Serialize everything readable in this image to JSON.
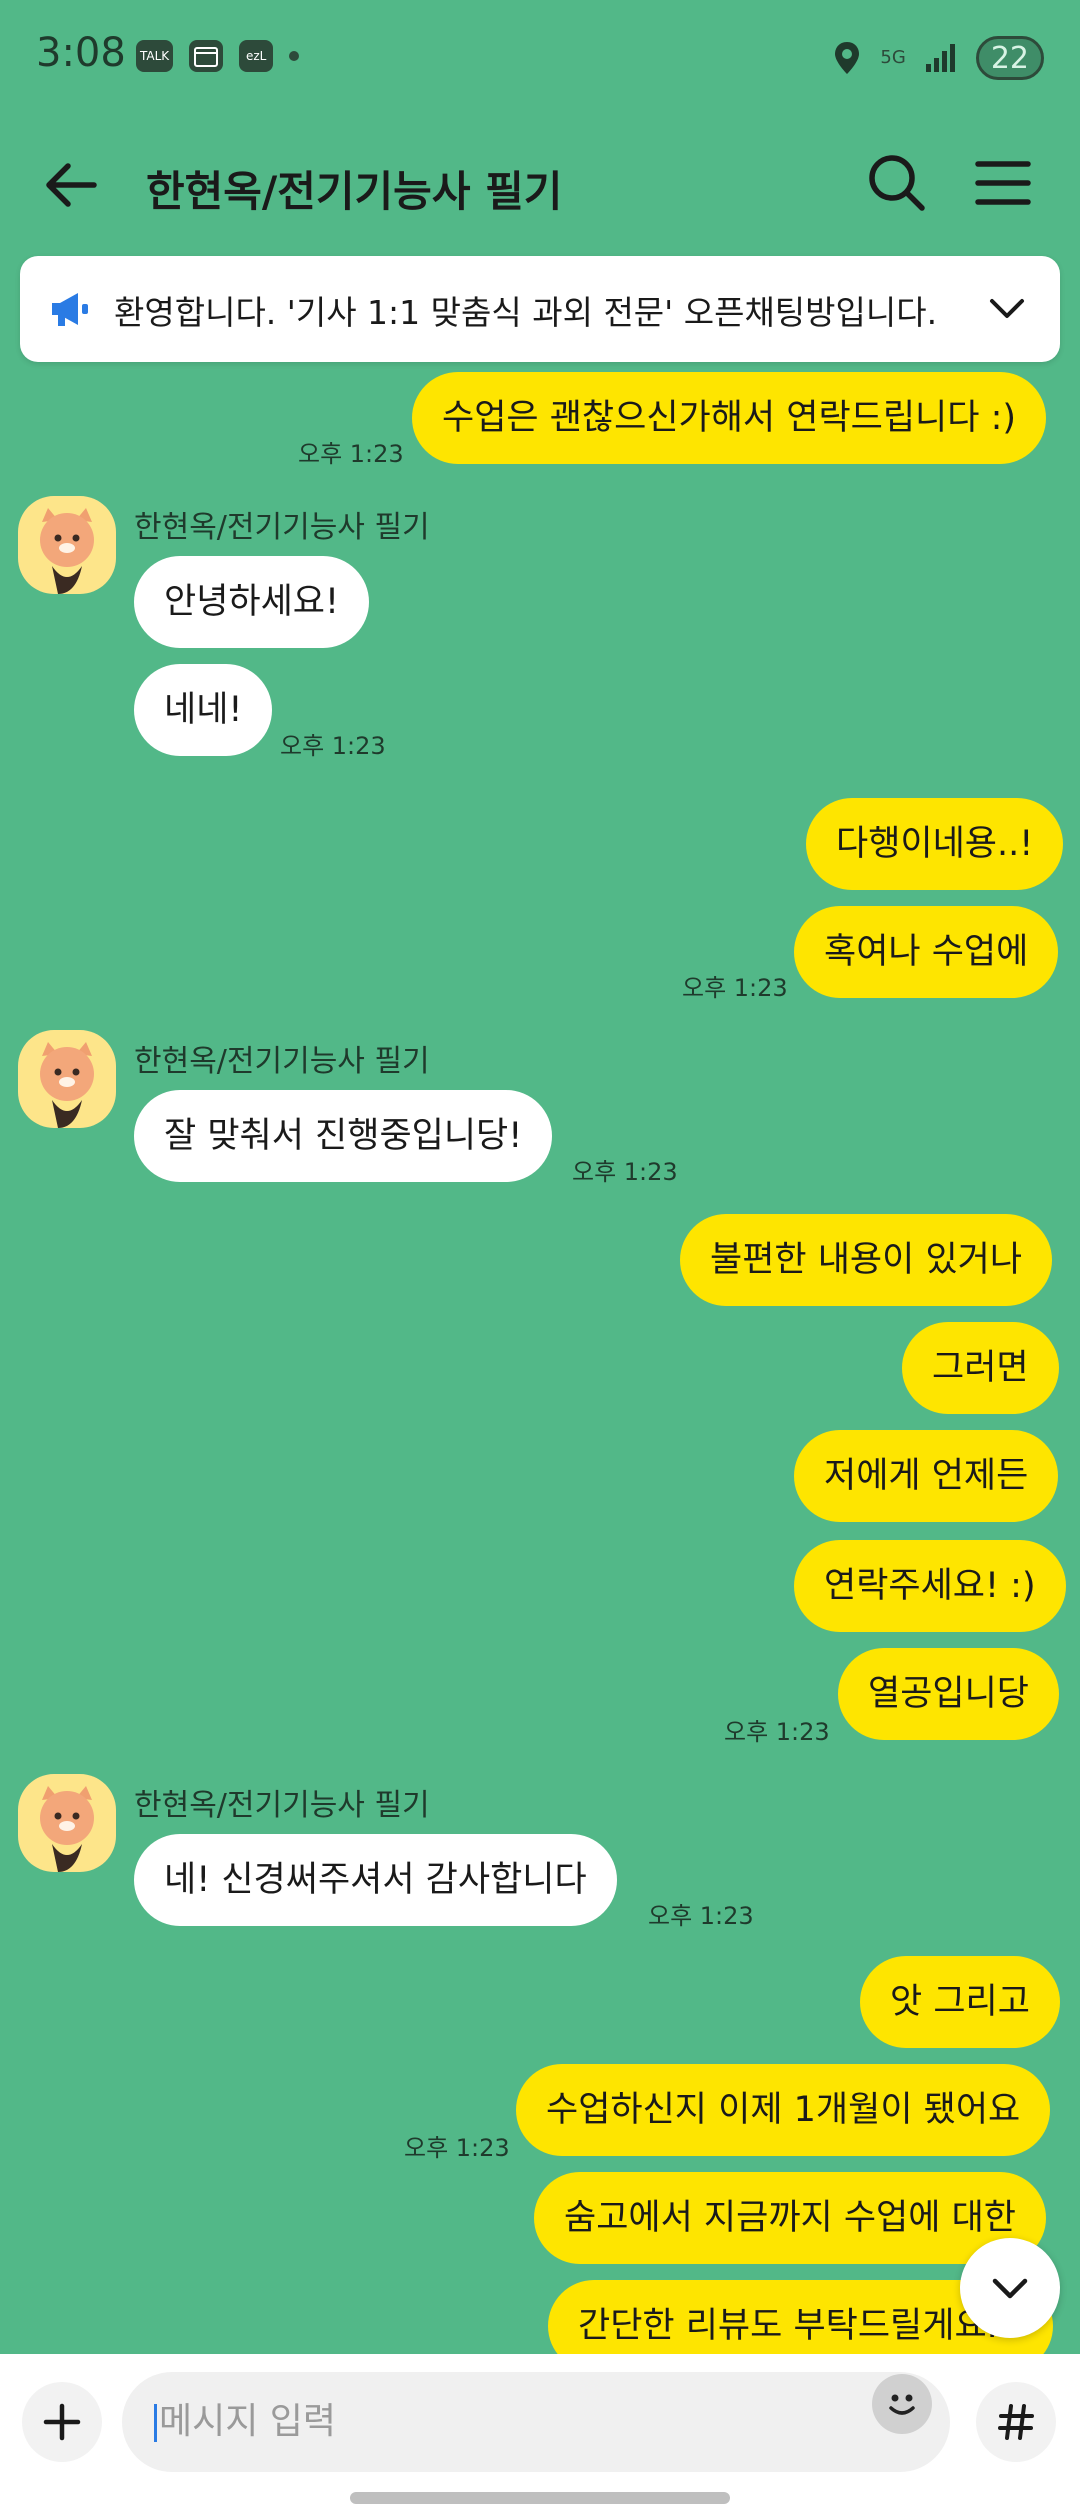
{
  "status_bar": {
    "time": "3:08",
    "chips": [
      "TALK",
      "",
      "ezL"
    ],
    "network": "5G",
    "battery": "22"
  },
  "header": {
    "title": "한현옥/전기기능사 필기"
  },
  "notice": {
    "text": "환영합니다. '기사 1:1 맞춤식 과외 전문' 오픈채팅방입니다."
  },
  "messages": [
    {
      "text": "수업은 괜찮으신가해서 연락드립니다 :)",
      "time": "오후 1:23"
    },
    {
      "sender": "한현옥/전기기능사 필기",
      "text": "안녕하세요!"
    },
    {
      "text": "네네!",
      "time": "오후 1:23"
    },
    {
      "text": "다행이네용..!"
    },
    {
      "text": "혹여나 수업에",
      "time": "오후 1:23"
    },
    {
      "sender": "한현옥/전기기능사 필기",
      "text": "잘 맞춰서 진행중입니당!",
      "time": "오후 1:23"
    },
    {
      "text": "불편한 내용이 있거나"
    },
    {
      "text": "그러면"
    },
    {
      "text": "저에게 언제든"
    },
    {
      "text": "연락주세요! :)"
    },
    {
      "text": "열공입니당",
      "time": "오후 1:23"
    },
    {
      "sender": "한현옥/전기기능사 필기",
      "text": "네! 신경써주셔서 감사합니다",
      "time": "오후 1:23"
    },
    {
      "text": "앗 그리고"
    },
    {
      "text": "수업하신지 이제 1개월이 됐어요",
      "time": "오후 1:23"
    },
    {
      "text": "숨고에서 지금까지 수업에 대한"
    },
    {
      "text": "간단한 리뷰도 부탁드릴게요..!"
    }
  ],
  "input": {
    "placeholder": "메시지 입력"
  },
  "colors": {
    "background": "#52b888",
    "my_bubble": "#fee500",
    "other_bubble": "#ffffff"
  }
}
